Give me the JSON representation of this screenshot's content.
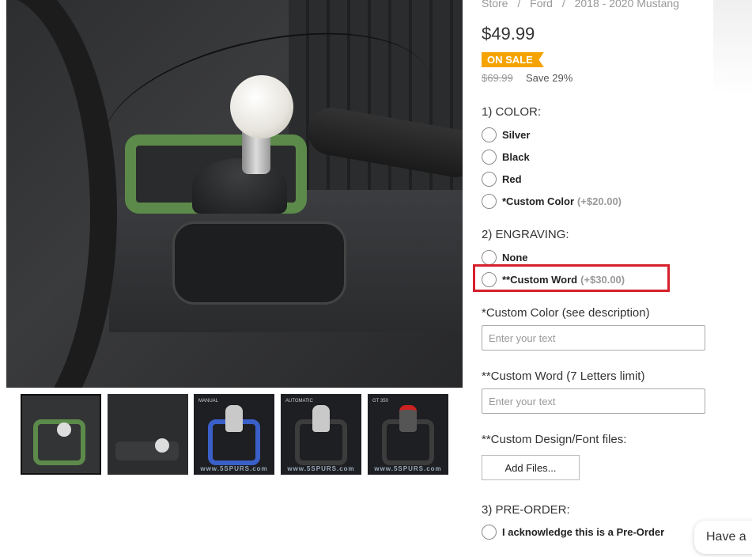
{
  "breadcrumb": [
    "Store",
    "Ford",
    "2018 - 2020 Mustang"
  ],
  "breadcrumb_separator": "/",
  "product": {
    "price": "$49.99",
    "sale_badge": "ON SALE",
    "old_price": "$69.99",
    "savings": "Save 29%"
  },
  "colors": {
    "sale_badge": "#f5a300",
    "highlight": "#d6202b"
  },
  "color_section": {
    "title": "1) COLOR:",
    "options": [
      {
        "label": "Silver",
        "extra": ""
      },
      {
        "label": "Black",
        "extra": ""
      },
      {
        "label": "Red",
        "extra": ""
      },
      {
        "label": "*Custom Color",
        "extra": "(+$20.00)"
      }
    ]
  },
  "engraving_section": {
    "title": "2) ENGRAVING:",
    "options": [
      {
        "label": "None",
        "extra": ""
      },
      {
        "label": "**Custom Word",
        "extra": "(+$30.00)"
      }
    ]
  },
  "custom_color_field": {
    "label": "*Custom Color (see description)",
    "placeholder": "Enter your text",
    "value": ""
  },
  "custom_word_field": {
    "label": "**Custom Word (7 Letters limit)",
    "placeholder": "Enter your text",
    "value": ""
  },
  "design_files": {
    "label": "**Custom Design/Font files:",
    "button": "Add Files..."
  },
  "preorder_section": {
    "title": "3) PRE-ORDER:",
    "option": "I acknowledge this is a Pre-Order"
  },
  "thumbnails": [
    {
      "tag": "",
      "brand": ""
    },
    {
      "tag": "",
      "brand": ""
    },
    {
      "tag": "MANUAL",
      "brand": "www.5SPURS.com"
    },
    {
      "tag": "AUTOMATIC",
      "brand": "www.5SPURS.com"
    },
    {
      "tag": "GT 350",
      "brand": "www.5SPURS.com"
    }
  ],
  "chat": {
    "label": "Have a"
  }
}
